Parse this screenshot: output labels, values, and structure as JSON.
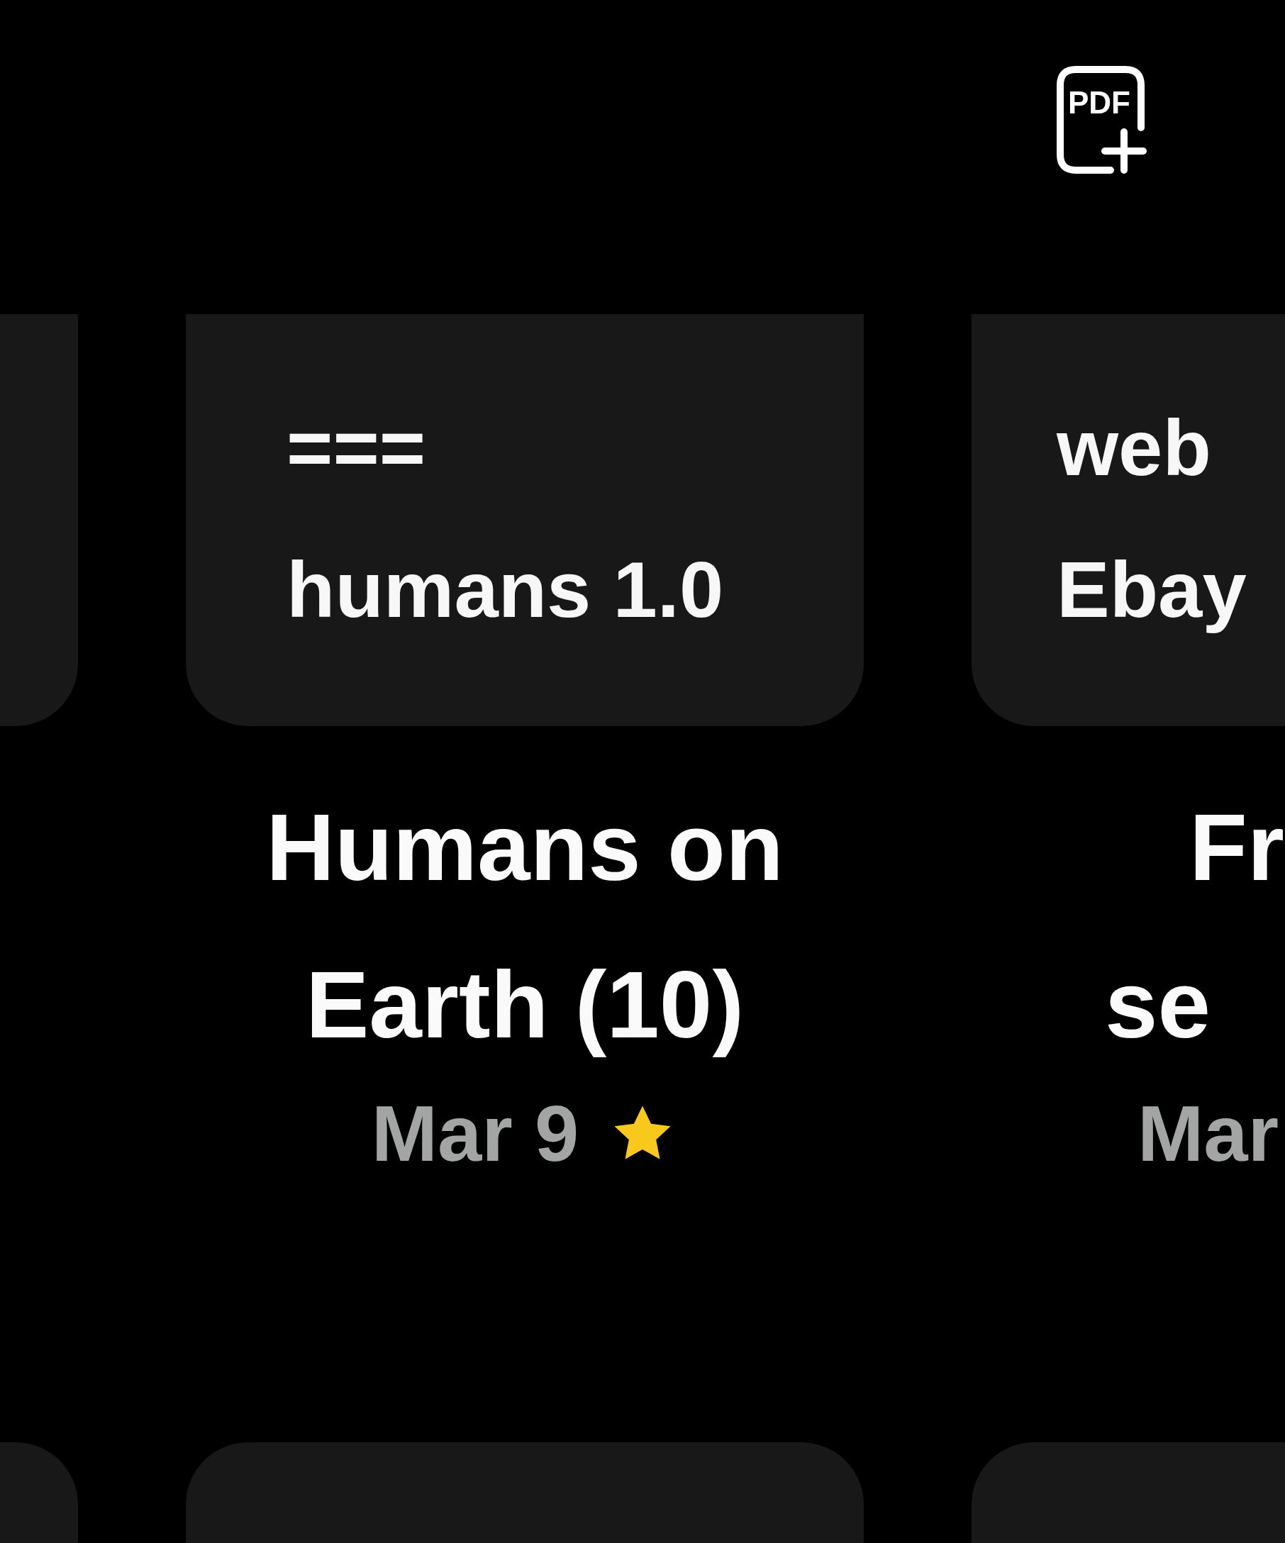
{
  "header": {
    "pdf_button": {
      "label": "PDF"
    }
  },
  "note_rows": [
    {
      "notes": [
        {
          "kind": "blank"
        },
        {
          "kind": "note",
          "preview_lines": [
            "===",
            "humans 1.0"
          ],
          "title_lines": [
            "Humans on",
            "Earth (10)"
          ],
          "date": "Mar 9",
          "starred": true
        },
        {
          "kind": "note",
          "preview_lines": [
            "web",
            "Ebay"
          ],
          "title_lines": [
            "Fr",
            "se"
          ],
          "date": "Mar"
        }
      ]
    },
    {
      "notes": [
        {
          "kind": "blank"
        },
        {
          "kind": "blank"
        },
        {
          "kind": "blank"
        }
      ]
    }
  ]
}
